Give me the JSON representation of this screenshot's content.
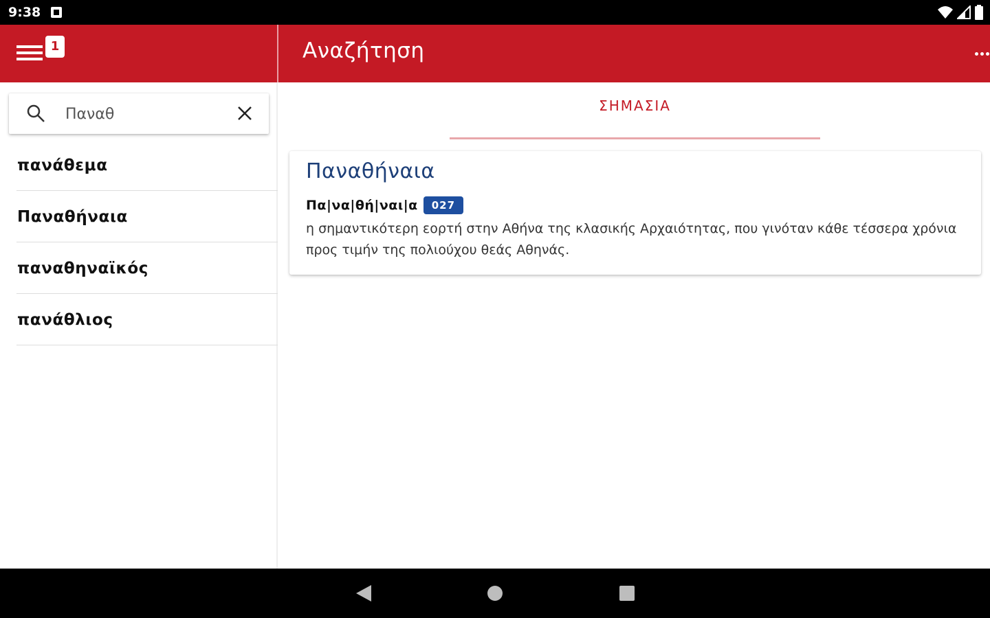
{
  "status_bar": {
    "time": "9:38",
    "icons": [
      "notification-icon",
      "wifi-icon",
      "signal-icon",
      "battery-icon"
    ]
  },
  "app_bar": {
    "title": "Αναζήτηση",
    "menu_badge": "1",
    "color": "#c41a25"
  },
  "search": {
    "value": "Παναθ",
    "placeholder": ""
  },
  "results": [
    {
      "label": "πανάθεμα"
    },
    {
      "label": "Παναθήναια"
    },
    {
      "label": "παναθηναϊκός"
    },
    {
      "label": "πανάθλιος"
    }
  ],
  "tabs": [
    {
      "label": "ΣΗΜΑΣΙΑ",
      "active": true
    }
  ],
  "entry": {
    "headword": "Παναθήναια",
    "syllables": "Πα|να|θή|ναι|α",
    "code": "027",
    "definition": "η σημαντικότερη εορτή στην Αθήνα της κλασικής Αρχαιότητας, που γινόταν κάθε τέσσερα χρόνια προς τιμήν της πολιούχου θεάς Αθηνάς."
  }
}
